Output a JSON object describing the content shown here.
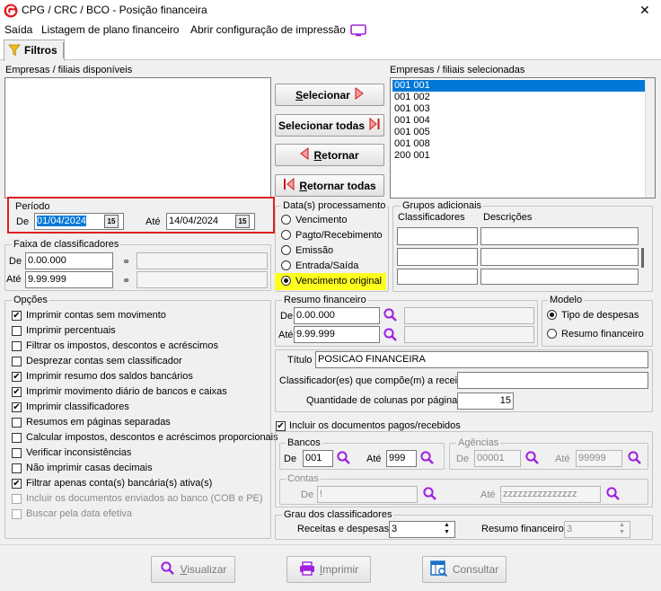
{
  "window": {
    "title": "CPG / CRC / BCO - Posição financeira",
    "close": "✕"
  },
  "menu": {
    "items": [
      "Saída",
      "Listagem de plano financeiro",
      "Abrir configuração de impressão"
    ]
  },
  "tab": {
    "label": "Filtros"
  },
  "empresas": {
    "available_label": "Empresas / filiais disponíveis",
    "selected_label": "Empresas / filiais selecionadas",
    "selected": [
      "001 001",
      "001 002",
      "001 003",
      "001 004",
      "001 005",
      "001 008",
      "200 001"
    ],
    "buttons": {
      "selecionar": "Selecionar",
      "selecionar_todas": "Selecionar todas",
      "retornar": "Retornar",
      "retornar_todas": "Retornar todas"
    }
  },
  "periodo": {
    "label": "Período",
    "de_label": "De",
    "de": "01/04/2024",
    "ate_label": "Até",
    "ate": "14/04/2024"
  },
  "datas": {
    "label": "Data(s) processamento",
    "options": [
      "Vencimento",
      "Pagto/Recebimento",
      "Emissão",
      "Entrada/Saída",
      "Vencimento original"
    ],
    "selected": "Vencimento original",
    "highlight": "#ffff1f"
  },
  "grupos": {
    "label": "Grupos adicionais",
    "col1": "Classificadores",
    "col2": "Descrições"
  },
  "faixa": {
    "label": "Faixa de classificadores",
    "de_label": "De",
    "de": "0.00.000",
    "ate_label": "Até",
    "ate": "9.99.999"
  },
  "opcoes": {
    "label": "Opções",
    "items": [
      {
        "label": "Imprimir contas sem movimento",
        "checked": "✔"
      },
      {
        "label": "Imprimir percentuais",
        "checked": ""
      },
      {
        "label": "Filtrar os impostos, descontos e acréscimos",
        "checked": ""
      },
      {
        "label": "Desprezar contas sem classificador",
        "checked": ""
      },
      {
        "label": "Imprimir resumo dos saldos bancários",
        "checked": "✔"
      },
      {
        "label": "Imprimir movimento diário de bancos e caixas",
        "checked": "✔"
      },
      {
        "label": "Imprimir classificadores",
        "checked": "✔"
      },
      {
        "label": "Resumos em páginas separadas",
        "checked": ""
      },
      {
        "label": "Calcular impostos, descontos e acréscimos proporcionais",
        "checked": ""
      },
      {
        "label": "Verificar inconsistências",
        "checked": ""
      },
      {
        "label": "Não imprimir casas decimais",
        "checked": ""
      },
      {
        "label": "Filtrar apenas conta(s) bancária(s) ativa(s)",
        "checked": "✔"
      },
      {
        "label": "Incluir os documentos enviados ao banco (COB e PE)",
        "checked": ""
      },
      {
        "label": "Buscar pela data efetiva",
        "checked": ""
      }
    ]
  },
  "resumo": {
    "label": "Resumo financeiro",
    "de_label": "De",
    "de": "0.00.000",
    "ate_label": "Até",
    "ate": "9.99.999"
  },
  "modelo": {
    "label": "Modelo",
    "options": [
      "Tipo de despesas",
      "Resumo financeiro"
    ],
    "selected": "Tipo de despesas"
  },
  "titulo": {
    "label": "Título",
    "value": "POSICAO FINANCEIRA"
  },
  "classificadores": {
    "label": "Classificador(es) que compõe(m) a receita",
    "value": ""
  },
  "colunas": {
    "label": "Quantidade de colunas por página",
    "value": "15"
  },
  "incluir_pagos": {
    "label": "Incluir os documentos pagos/recebidos",
    "checked": "✔"
  },
  "bancos": {
    "label": "Bancos",
    "de_label": "De",
    "de": "001",
    "ate_label": "Até",
    "ate": "999"
  },
  "agencias": {
    "label": "Agências",
    "de_label": "De",
    "de": "00001",
    "ate_label": "Até",
    "ate": "99999"
  },
  "contas": {
    "label": "Contas",
    "de_label": "De",
    "de": "!",
    "ate_label": "Até",
    "ate": "zzzzzzzzzzzzzzz"
  },
  "grau": {
    "label": "Grau dos classificadores",
    "receitas_label": "Receitas e despesas",
    "receitas": "3",
    "resumo_label": "Resumo financeiro",
    "resumo": "3"
  },
  "footer": {
    "visualizar": "Visualizar",
    "imprimir": "Imprimir",
    "consultar": "Consultar"
  },
  "colors": {
    "accent": "#1b7bd4",
    "highlight_border": "#e02020",
    "selection": "#0078d7"
  }
}
